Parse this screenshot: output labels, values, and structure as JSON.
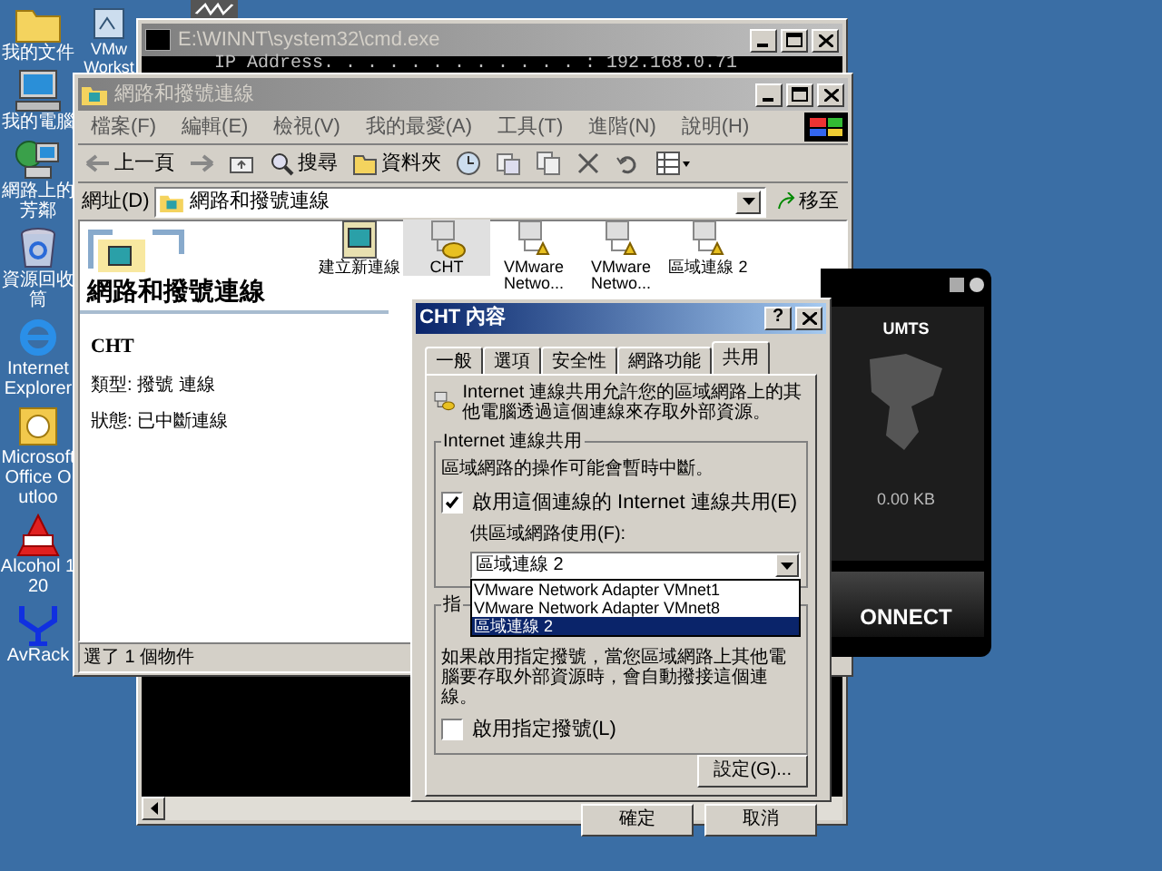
{
  "desktop_icons": [
    {
      "label": "我的文件",
      "kind": "folder"
    },
    {
      "label": "我的電腦",
      "kind": "computer"
    },
    {
      "label": "網路上的芳鄰",
      "kind": "network"
    },
    {
      "label": "資源回收筒",
      "kind": "recycle"
    },
    {
      "label": "Internet Explorer",
      "kind": "browser"
    },
    {
      "label": "Microsoft Office Outloo",
      "kind": "mail"
    },
    {
      "label": "Alcohol 120",
      "kind": "alcohol"
    },
    {
      "label": "AvRack",
      "kind": "antenna"
    }
  ],
  "vmware_icon": {
    "label": "VMw Workst"
  },
  "cmd": {
    "title": "E:\\WINNT\\system32\\cmd.exe",
    "active": false,
    "lines": [
      "IP Address. . . . . . . . . . . . : 192.168.0.71"
    ]
  },
  "explorer": {
    "title": "網路和撥號連線",
    "active": false,
    "menu": [
      "檔案(F)",
      "編輯(E)",
      "檢視(V)",
      "我的最愛(A)",
      "工具(T)",
      "進階(N)",
      "說明(H)"
    ],
    "toolbar": [
      {
        "kind": "back",
        "label": "上一頁"
      },
      {
        "kind": "forward"
      },
      {
        "kind": "up"
      },
      {
        "kind": "search",
        "label": "搜尋"
      },
      {
        "kind": "folders",
        "label": "資料夾"
      },
      {
        "kind": "history"
      },
      {
        "kind": "move"
      },
      {
        "kind": "copy"
      },
      {
        "kind": "delete"
      },
      {
        "kind": "undo"
      },
      {
        "kind": "views"
      }
    ],
    "address": {
      "label": "網址(D)",
      "value": "網路和撥號連線",
      "go": "移至"
    },
    "pane": {
      "heading": "網路和撥號連線",
      "name": "CHT",
      "details": [
        "類型: 撥號 連線",
        "狀態: 已中斷連線"
      ]
    },
    "items": [
      {
        "label": "建立新連線",
        "kind": "wizard",
        "selected": false
      },
      {
        "label": "CHT",
        "kind": "dialup",
        "selected": true
      },
      {
        "label": "VMware Netwo...",
        "kind": "lan",
        "selected": false
      },
      {
        "label": "VMware Netwo...",
        "kind": "lan",
        "selected": false
      },
      {
        "label": "區域連線 2",
        "kind": "lan",
        "selected": false
      }
    ],
    "status": "選了 1 個物件"
  },
  "dialog": {
    "title": "CHT 內容",
    "active": true,
    "help": "?",
    "tabs": [
      {
        "label": "一般",
        "selected": false
      },
      {
        "label": "選項",
        "selected": false
      },
      {
        "label": "安全性",
        "selected": false
      },
      {
        "label": "網路功能",
        "selected": false
      },
      {
        "label": "共用",
        "selected": true
      }
    ],
    "intro": "Internet 連線共用允許您的區域網路上的其他電腦透過這個連線來存取外部資源。",
    "group": "Internet 連線共用",
    "notice": "區域網路的操作可能會暫時中斷。",
    "share_checkbox": {
      "label": "啟用這個連線的 Internet 連線共用(E)",
      "checked": true
    },
    "dropdown_label": "供區域網路使用(F):",
    "dropdown": {
      "value": "區域連線 2",
      "options": [
        {
          "label": "VMware Network Adapter VMnet1",
          "selected": false
        },
        {
          "label": "VMware Network Adapter VMnet8",
          "selected": false
        },
        {
          "label": "區域連線 2",
          "selected": true
        }
      ]
    },
    "group2": "指",
    "dial_text": "如果啟用指定撥號，當您區域網路上其他電腦要存取外部資源時，會自動撥接這個連線。",
    "dial_checkbox": {
      "label": "啟用指定撥號(L)",
      "checked": false
    },
    "settings": "設定(G)...",
    "buttons": [
      "確定",
      "取消"
    ]
  },
  "modem_app": {
    "network": "UMTS",
    "traffic": "0.00 KB",
    "button": "ONNECT"
  }
}
